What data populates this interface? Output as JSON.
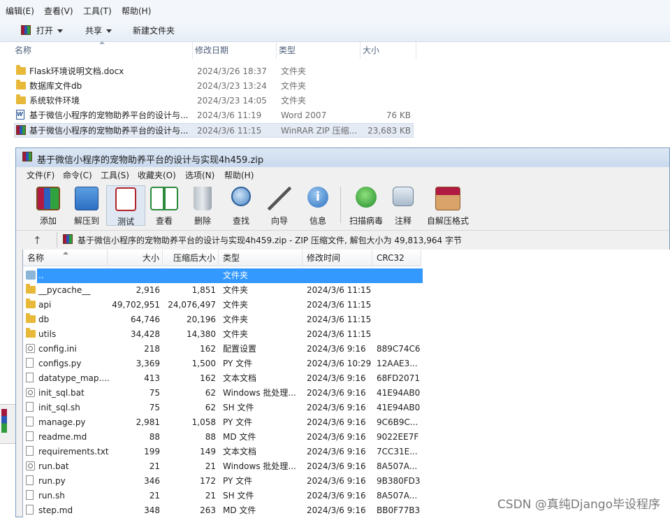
{
  "explorer": {
    "menu": [
      "编辑(E)",
      "查看(V)",
      "工具(T)",
      "帮助(H)"
    ],
    "toolbar": {
      "open": "打开",
      "share": "共享",
      "new_folder": "新建文件夹"
    },
    "columns": {
      "name": "名称",
      "modified": "修改日期",
      "type": "类型",
      "size": "大小"
    },
    "rows": [
      {
        "name": "Flask环境说明文档.docx",
        "modified": "2024/3/26 18:37",
        "type": "文件夹",
        "size": "",
        "icon": "folder-icon"
      },
      {
        "name": "数据库文件db",
        "modified": "2024/3/23 13:24",
        "type": "文件夹",
        "size": "",
        "icon": "folder-icon"
      },
      {
        "name": "系统软件环境",
        "modified": "2024/3/23 14:05",
        "type": "文件夹",
        "size": "",
        "icon": "folder-icon"
      },
      {
        "name": "基于微信小程序的宠物助养平台的设计与...",
        "modified": "2024/3/6 11:19",
        "type": "Word 2007",
        "size": "76 KB",
        "icon": "word-doc-icon"
      },
      {
        "name": "基于微信小程序的宠物助养平台的设计与...",
        "modified": "2024/3/6 11:15",
        "type": "WinRAR ZIP 压缩...",
        "size": "23,683 KB",
        "icon": "winrar-zip-icon"
      }
    ]
  },
  "winrar": {
    "title": "基于微信小程序的宠物助养平台的设计与实现4h459.zip",
    "menu": [
      "文件(F)",
      "命令(C)",
      "工具(S)",
      "收藏夹(O)",
      "选项(N)",
      "帮助(H)"
    ],
    "toolbar": [
      {
        "label": "添加",
        "icon": "add-archive-icon"
      },
      {
        "label": "解压到",
        "icon": "extract-to-icon"
      },
      {
        "label": "测试",
        "icon": "test-icon"
      },
      {
        "label": "查看",
        "icon": "view-book-icon"
      },
      {
        "label": "删除",
        "icon": "trash-icon"
      },
      {
        "label": "查找",
        "icon": "find-magnifier-icon"
      },
      {
        "label": "向导",
        "icon": "wizard-icon"
      },
      {
        "label": "信息",
        "icon": "info-icon"
      },
      {
        "label": "扫描病毒",
        "icon": "virus-scan-icon"
      },
      {
        "label": "注释",
        "icon": "comment-icon"
      },
      {
        "label": "自解压格式",
        "icon": "sfx-icon"
      }
    ],
    "address": "基于微信小程序的宠物助养平台的设计与实现4h459.zip - ZIP 压缩文件, 解包大小为 49,813,964 字节",
    "columns": {
      "name": "名称",
      "size": "大小",
      "packed": "压缩后大小",
      "type": "类型",
      "modified": "修改时间",
      "crc": "CRC32"
    },
    "rows": [
      {
        "name": "..",
        "size": "",
        "packed": "",
        "type": "文件夹",
        "modified": "",
        "crc": "",
        "icon": "up-folder"
      },
      {
        "name": "__pycache__",
        "size": "2,916",
        "packed": "1,851",
        "type": "文件夹",
        "modified": "2024/3/6 11:15",
        "crc": "",
        "icon": "folder"
      },
      {
        "name": "api",
        "size": "49,702,951",
        "packed": "24,076,497",
        "type": "文件夹",
        "modified": "2024/3/6 11:15",
        "crc": "",
        "icon": "folder"
      },
      {
        "name": "db",
        "size": "64,746",
        "packed": "20,196",
        "type": "文件夹",
        "modified": "2024/3/6 11:15",
        "crc": "",
        "icon": "folder"
      },
      {
        "name": "utils",
        "size": "34,428",
        "packed": "14,380",
        "type": "文件夹",
        "modified": "2024/3/6 11:15",
        "crc": "",
        "icon": "folder"
      },
      {
        "name": "config.ini",
        "size": "218",
        "packed": "162",
        "type": "配置设置",
        "modified": "2024/3/6 9:16",
        "crc": "889C74C6",
        "icon": "settings-file"
      },
      {
        "name": "configs.py",
        "size": "3,369",
        "packed": "1,500",
        "type": "PY 文件",
        "modified": "2024/3/6 10:29",
        "crc": "12AAE3...",
        "icon": "file"
      },
      {
        "name": "datatype_map....",
        "size": "413",
        "packed": "162",
        "type": "文本文档",
        "modified": "2024/3/6 9:16",
        "crc": "68FD2071",
        "icon": "text-file"
      },
      {
        "name": "init_sql.bat",
        "size": "75",
        "packed": "62",
        "type": "Windows 批处理...",
        "modified": "2024/3/6 9:16",
        "crc": "41E94AB0",
        "icon": "settings-file"
      },
      {
        "name": "init_sql.sh",
        "size": "75",
        "packed": "62",
        "type": "SH 文件",
        "modified": "2024/3/6 9:16",
        "crc": "41E94AB0",
        "icon": "file"
      },
      {
        "name": "manage.py",
        "size": "2,981",
        "packed": "1,058",
        "type": "PY 文件",
        "modified": "2024/3/6 9:16",
        "crc": "9C6B9C...",
        "icon": "file"
      },
      {
        "name": "readme.md",
        "size": "88",
        "packed": "88",
        "type": "MD 文件",
        "modified": "2024/3/6 9:16",
        "crc": "9022EE7F",
        "icon": "file"
      },
      {
        "name": "requirements.txt",
        "size": "199",
        "packed": "149",
        "type": "文本文档",
        "modified": "2024/3/6 9:16",
        "crc": "7CC31E...",
        "icon": "text-file"
      },
      {
        "name": "run.bat",
        "size": "21",
        "packed": "21",
        "type": "Windows 批处理...",
        "modified": "2024/3/6 9:16",
        "crc": "8A507A...",
        "icon": "settings-file"
      },
      {
        "name": "run.py",
        "size": "346",
        "packed": "172",
        "type": "PY 文件",
        "modified": "2024/3/6 9:16",
        "crc": "9B380FD3",
        "icon": "file"
      },
      {
        "name": "run.sh",
        "size": "21",
        "packed": "21",
        "type": "SH 文件",
        "modified": "2024/3/6 9:16",
        "crc": "8A507A...",
        "icon": "file"
      },
      {
        "name": "step.md",
        "size": "348",
        "packed": "263",
        "type": "MD 文件",
        "modified": "2024/3/6 9:16",
        "crc": "BB0F77B3",
        "icon": "file"
      }
    ]
  },
  "watermark": "CSDN @真纯Django毕设程序"
}
